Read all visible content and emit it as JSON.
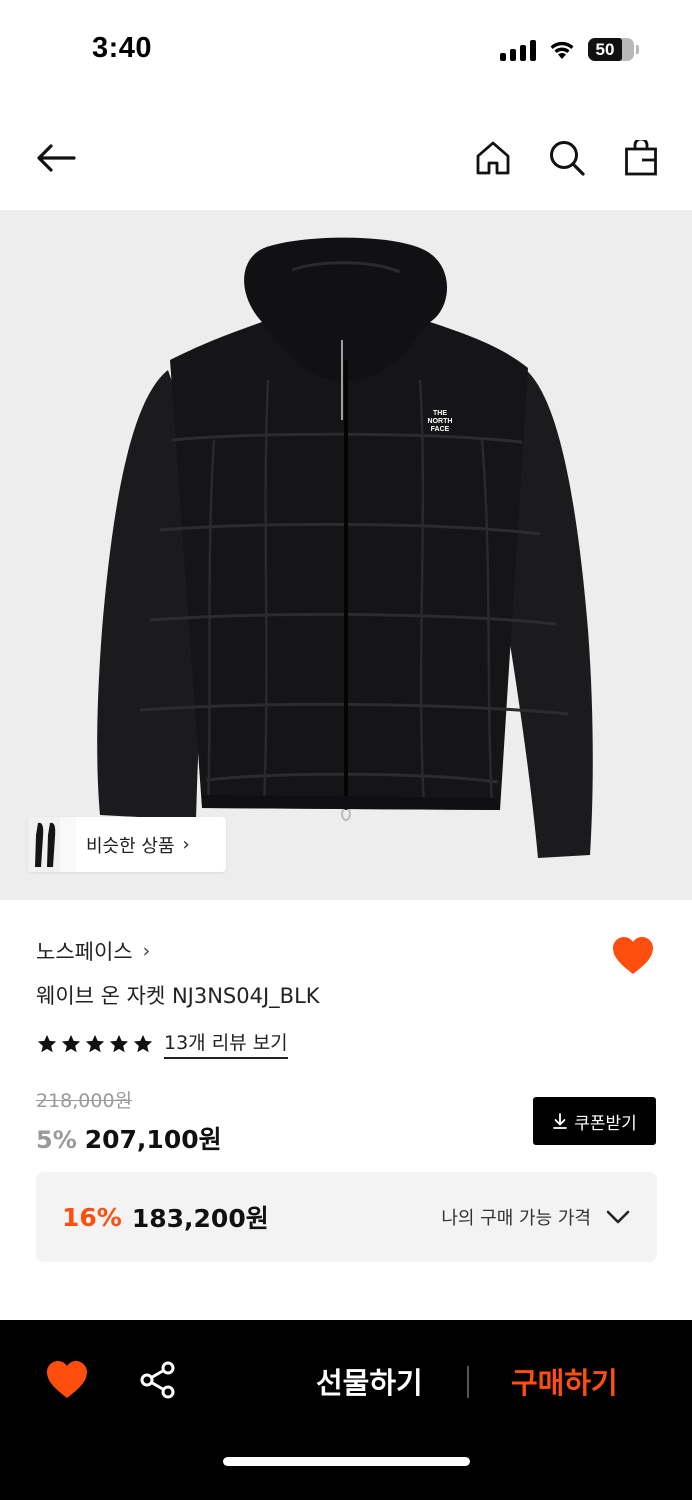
{
  "status_bar": {
    "time": "3:40",
    "battery": "50"
  },
  "nav": {
    "back_icon": "arrow-left-icon",
    "home_icon": "home-icon",
    "search_icon": "search-icon",
    "cart_icon": "shopping-bag-icon"
  },
  "image": {
    "similar_label": "비슷한 상품",
    "similar_chevron": "›",
    "jacket_logo_line1": "THE",
    "jacket_logo_line2": "NORTH",
    "jacket_logo_line3": "FACE"
  },
  "product": {
    "brand": "노스페이스",
    "brand_chevron": "›",
    "name": "웨이브 온 자켓 NJ3NS04J_BLK",
    "rating_stars": 5,
    "review_link": "13개 리뷰 보기",
    "original_price": "218,000원",
    "discount": "5%",
    "price": "207,100원",
    "coupon_label": "쿠폰받기"
  },
  "my_price": {
    "discount": "16%",
    "price": "183,200원",
    "label": "나의 구매 가능 가격"
  },
  "bottom_bar": {
    "gift_label": "선물하기",
    "buy_label": "구매하기"
  },
  "colors": {
    "accent": "#ff4e0e",
    "dark": "#000000",
    "image_bg": "#ededed",
    "price_box_bg": "#f3f3f3"
  }
}
